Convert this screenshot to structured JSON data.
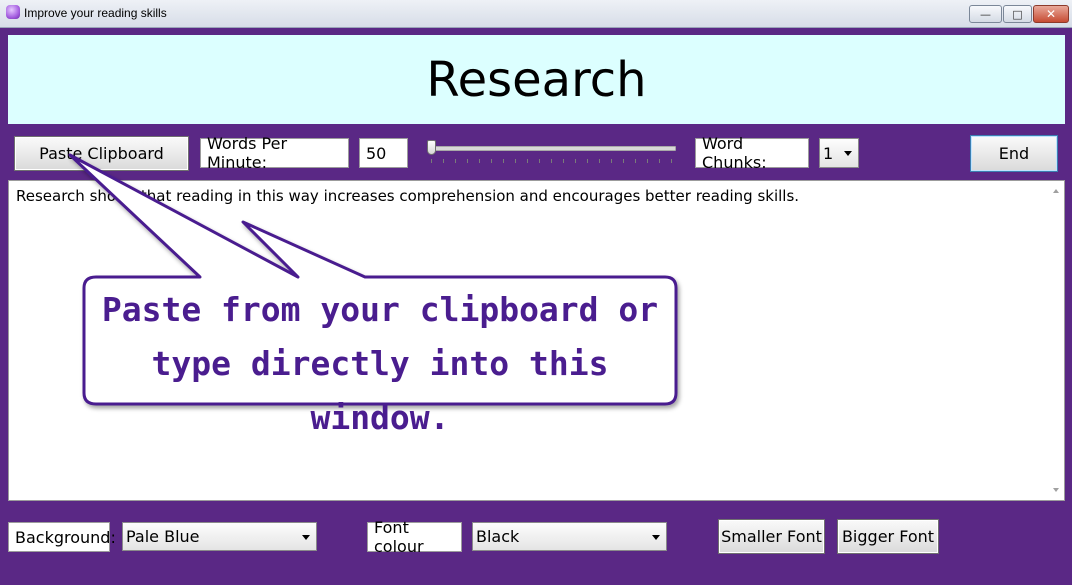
{
  "window": {
    "title": "Improve your reading skills",
    "minimize_glyph": "—",
    "maximize_glyph": "□",
    "close_glyph": "✕"
  },
  "header": {
    "title": "Research"
  },
  "toolbar": {
    "paste_label": "Paste Clipboard",
    "wpm_label": "Words Per Minute:",
    "wpm_value": "50",
    "speed_slider": {
      "value": 0,
      "min": 0,
      "max": 1
    },
    "chunks_label": "Word Chunks:",
    "chunks_value": "1",
    "end_label": "End"
  },
  "textarea": {
    "content": "Research shows that reading in this way increases comprehension and encourages better reading skills."
  },
  "callout": {
    "text": "Paste from your clipboard or\ntype directly into this window."
  },
  "bottom": {
    "background_label": "Background:",
    "background_value": "Pale Blue",
    "font_colour_label": "Font colour",
    "font_colour_value": "Black",
    "smaller_font_label": "Smaller Font",
    "bigger_font_label": "Bigger Font"
  },
  "colors": {
    "frame": "#5a2885",
    "header_bg": "#dcffff",
    "callout_text": "#4a1d8f",
    "callout_border": "#4a1d8f"
  }
}
